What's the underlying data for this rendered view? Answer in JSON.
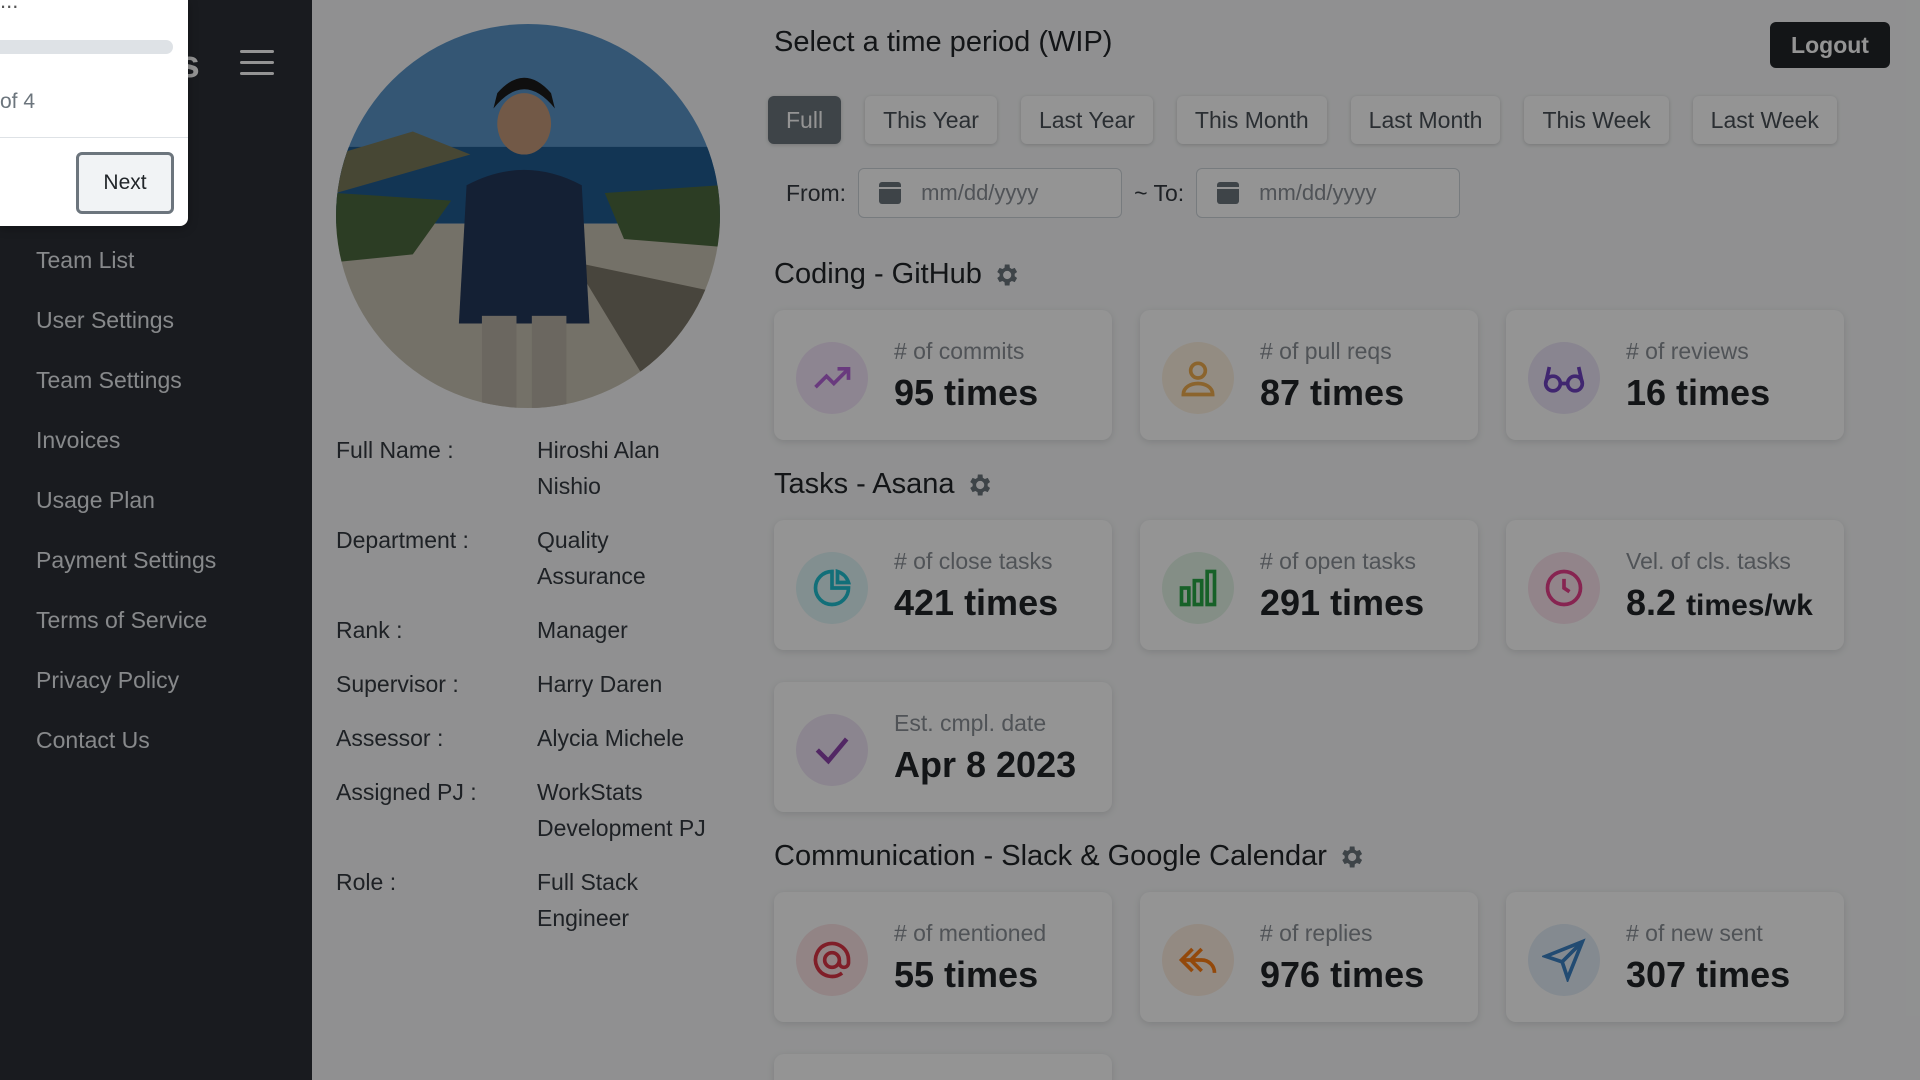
{
  "sidebar": {
    "brand_fragment": "ts",
    "items": [
      {
        "label": "Team List"
      },
      {
        "label": "User Settings"
      },
      {
        "label": "Team Settings"
      },
      {
        "label": "Invoices"
      },
      {
        "label": "Usage Plan"
      },
      {
        "label": "Payment Settings"
      },
      {
        "label": "Terms of Service"
      },
      {
        "label": "Privacy Policy"
      },
      {
        "label": "Contact Us"
      }
    ]
  },
  "profile": {
    "rows": [
      {
        "label": "Full Name :",
        "value": "Hiroshi Alan Nishio"
      },
      {
        "label": "Department :",
        "value": "Quality Assurance"
      },
      {
        "label": "Rank :",
        "value": "Manager"
      },
      {
        "label": "Supervisor :",
        "value": "Harry Daren"
      },
      {
        "label": "Assessor :",
        "value": "Alycia Michele"
      },
      {
        "label": "Assigned PJ :",
        "value": "WorkStats Development PJ"
      },
      {
        "label": "Role :",
        "value": "Full Stack Engineer"
      }
    ]
  },
  "header": {
    "period_title": "Select a time period (WIP)",
    "logout_label": "Logout",
    "periods": [
      "Full",
      "This Year",
      "Last Year",
      "This Month",
      "Last Month",
      "This Week",
      "Last Week"
    ],
    "active_period": "Full",
    "from_label": "From:",
    "to_label": "~ To:",
    "date_placeholder": "mm/dd/yyyy"
  },
  "sections": {
    "coding": {
      "title": "Coding - GitHub",
      "cards": [
        {
          "label": "# of commits",
          "value": "95 times",
          "icon": "trend-up-icon",
          "color": "#b565d9"
        },
        {
          "label": "# of pull reqs",
          "value": "87 times",
          "icon": "user-icon",
          "color": "#f0ad4e"
        },
        {
          "label": "# of reviews",
          "value": "16 times",
          "icon": "glasses-icon",
          "color": "#6f42c1"
        }
      ]
    },
    "tasks": {
      "title": "Tasks - Asana",
      "cards": [
        {
          "label": "# of close tasks",
          "value": "421 times",
          "icon": "pie-chart-icon",
          "color": "#20c0d0"
        },
        {
          "label": "# of open tasks",
          "value": "291 times",
          "icon": "bar-chart-icon",
          "color": "#28a745"
        },
        {
          "label": "Vel. of cls. tasks",
          "value": "8.2",
          "unit": "times/wk",
          "icon": "clock-icon",
          "color": "#e83e8c"
        },
        {
          "label": "Est. cmpl. date",
          "value": "Apr 8 2023",
          "icon": "check-icon",
          "color": "#8e44ad"
        }
      ]
    },
    "communication": {
      "title": "Communication - Slack & Google Calendar",
      "cards": [
        {
          "label": "# of mentioned",
          "value": "55 times",
          "icon": "at-icon",
          "color": "#dc3545"
        },
        {
          "label": "# of replies",
          "value": "976 times",
          "icon": "reply-icon",
          "color": "#fd7e14"
        },
        {
          "label": "# of new sent",
          "value": "307 times",
          "icon": "send-icon",
          "color": "#3b82c4"
        }
      ]
    }
  },
  "tour": {
    "step_text": "of 4",
    "next_label": "Next",
    "dots": "..."
  }
}
